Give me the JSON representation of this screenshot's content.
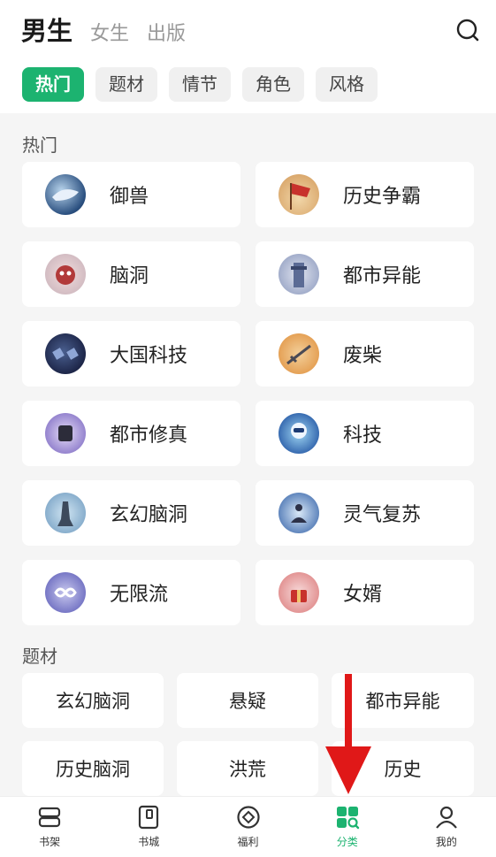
{
  "header": {
    "tabs": [
      {
        "label": "男生"
      },
      {
        "label": "女生"
      },
      {
        "label": "出版"
      }
    ]
  },
  "chips": [
    {
      "label": "热门"
    },
    {
      "label": "题材"
    },
    {
      "label": "情节"
    },
    {
      "label": "角色"
    },
    {
      "label": "风格"
    }
  ],
  "hot": {
    "title": "热门",
    "items": [
      {
        "label": "御兽",
        "icon": "whale-art-icon"
      },
      {
        "label": "历史争霸",
        "icon": "flag-art-icon"
      },
      {
        "label": "脑洞",
        "icon": "creature-art-icon"
      },
      {
        "label": "都市异能",
        "icon": "tower-art-icon"
      },
      {
        "label": "大国科技",
        "icon": "satellite-art-icon"
      },
      {
        "label": "废柴",
        "icon": "sword-art-icon"
      },
      {
        "label": "都市修真",
        "icon": "fist-art-icon"
      },
      {
        "label": "科技",
        "icon": "robot-art-icon"
      },
      {
        "label": "玄幻脑洞",
        "icon": "warrior-art-icon"
      },
      {
        "label": "灵气复苏",
        "icon": "meditation-art-icon"
      },
      {
        "label": "无限流",
        "icon": "infinity-art-icon"
      },
      {
        "label": "女婿",
        "icon": "gift-art-icon"
      }
    ]
  },
  "theme": {
    "title": "题材",
    "items": [
      {
        "label": "玄幻脑洞"
      },
      {
        "label": "悬疑"
      },
      {
        "label": "都市异能"
      },
      {
        "label": "历史脑洞"
      },
      {
        "label": "洪荒"
      },
      {
        "label": "历史"
      }
    ]
  },
  "nav": {
    "items": [
      {
        "label": "书架",
        "icon": "bookshelf-icon"
      },
      {
        "label": "书城",
        "icon": "bookstore-icon"
      },
      {
        "label": "福利",
        "icon": "welfare-icon"
      },
      {
        "label": "分类",
        "icon": "category-icon"
      },
      {
        "label": "我的",
        "icon": "profile-icon"
      }
    ]
  },
  "colors": {
    "accent": "#1cb370",
    "arrow": "#e01818"
  }
}
